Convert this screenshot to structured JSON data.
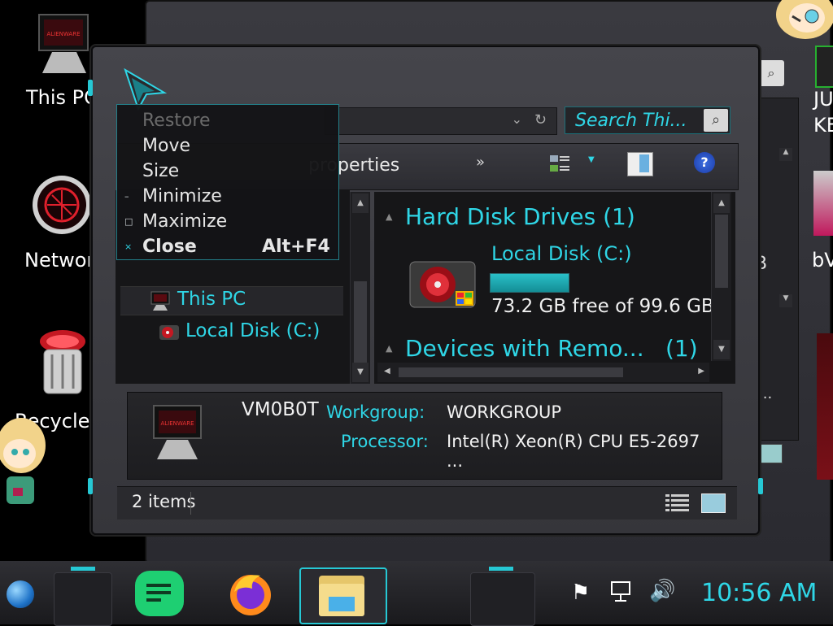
{
  "desktop": {
    "icons": [
      {
        "label": "This PC"
      },
      {
        "label": "Network"
      },
      {
        "label": "Recycle Bin"
      }
    ],
    "right_edge_labels": [
      "JU",
      "KE",
      "bV"
    ]
  },
  "back_window": {
    "partial_text_gb": "B",
    "partial_text_dots": "..."
  },
  "explorer": {
    "search_placeholder": "Search Thi...",
    "toolbar": {
      "properties_label": "properties",
      "chevron": "»"
    },
    "nav_pane": {
      "items": [
        {
          "label": "This PC"
        },
        {
          "label": "Local Disk (C:)"
        }
      ]
    },
    "content": {
      "groups": [
        {
          "title": "Hard Disk Drives (1)"
        },
        {
          "title": "Devices with Remo...",
          "count": "(1)"
        }
      ],
      "drive": {
        "name": "Local Disk (C:)",
        "usage_fraction": 0.265,
        "free_text": "73.2 GB free of 99.6 GB"
      }
    },
    "details": {
      "computer_name": "VM0B0T",
      "rows": [
        {
          "label": "Workgroup:",
          "value": "WORKGROUP"
        },
        {
          "label": "Processor:",
          "value": "Intel(R) Xeon(R) CPU E5-2697 ..."
        }
      ]
    },
    "status": {
      "items_count": "2 items"
    }
  },
  "context_menu": {
    "items": [
      {
        "label": "Restore",
        "mark": "",
        "disabled": true
      },
      {
        "label": "Move",
        "mark": ""
      },
      {
        "label": "Size",
        "mark": ""
      },
      {
        "label": "Minimize",
        "mark": "–"
      },
      {
        "label": "Maximize",
        "mark": "□"
      },
      {
        "label": "Close",
        "mark": "×",
        "shortcut": "Alt+F4"
      }
    ]
  },
  "taskbar": {
    "clock": "10:56 AM"
  },
  "colors": {
    "accent": "#2fd6e6",
    "window_bg": "#3a3a40",
    "pane_bg": "#161618",
    "progress": "#1aa5ad"
  }
}
